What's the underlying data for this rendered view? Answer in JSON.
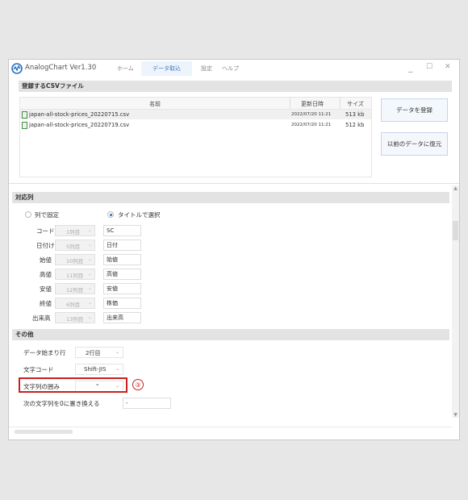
{
  "app": {
    "name": "AnalogChart Ver1.30",
    "tabs": [
      "ホーム",
      "データ取込",
      "設定",
      "ヘルプ"
    ],
    "active_tab": "データ取込",
    "minimize": "_",
    "maximize": "☐",
    "close": "✕"
  },
  "files_section": {
    "title": "登録するCSVファイル",
    "headers": {
      "name": "名前",
      "date": "更新日時",
      "size": "サイズ"
    },
    "rows": [
      {
        "name": "japan-all-stock-prices_20220715.csv",
        "date": "2022/07/20 11:21",
        "size": "513 kb"
      },
      {
        "name": "japan-all-stock-prices_20220719.csv",
        "date": "2022/07/20 11:21",
        "size": "512 kb"
      }
    ],
    "register_button": "データを登録",
    "restore_button": "以前のデータに復元"
  },
  "mapping_section": {
    "title": "対応列",
    "radio_fixed": "列で固定",
    "radio_title": "タイトルで選択",
    "rows": [
      {
        "label": "コード",
        "column": "1列目",
        "value": "SC"
      },
      {
        "label": "日付け",
        "column": "5列目",
        "value": "日付"
      },
      {
        "label": "始値",
        "column": "10列目",
        "value": "始値"
      },
      {
        "label": "高値",
        "column": "11列目",
        "value": "高値"
      },
      {
        "label": "安値",
        "column": "12列目",
        "value": "安値"
      },
      {
        "label": "終値",
        "column": "6列目",
        "value": "株価"
      },
      {
        "label": "出来高",
        "column": "13列目",
        "value": "出来高"
      }
    ]
  },
  "other_section": {
    "title": "その他",
    "start_row_label": "データ始まり行",
    "start_row_value": "2行目",
    "encoding_label": "文字コード",
    "encoding_value": "Shift-JIS",
    "quote_label": "文字列の囲み",
    "quote_value": "\"",
    "replace_label": "次の文字列を0に置き換える",
    "replace_value": "-"
  },
  "annotation": {
    "marker": "③",
    "color": "#c82020"
  },
  "colors": {
    "accent": "#3a78c2",
    "section_bg": "#e3e3e3"
  }
}
